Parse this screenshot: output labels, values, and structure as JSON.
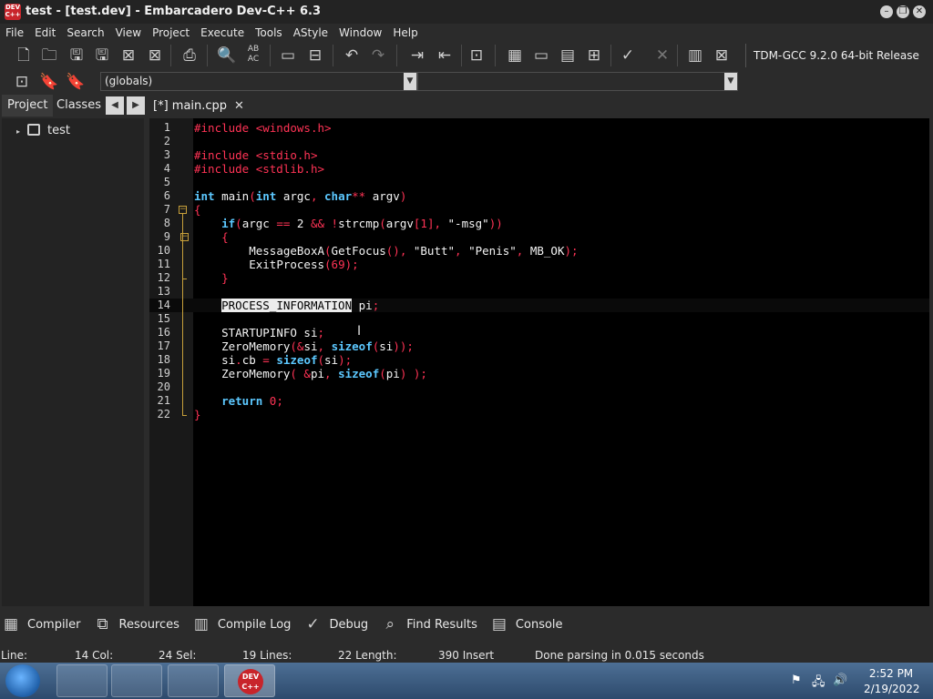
{
  "window": {
    "title": "test - [test.dev] - Embarcadero Dev-C++ 6.3",
    "logo_text": "DEV C++"
  },
  "menu": [
    "File",
    "Edit",
    "Search",
    "View",
    "Project",
    "Execute",
    "Tools",
    "AStyle",
    "Window",
    "Help"
  ],
  "toolbar": {
    "compiler": "TDM-GCC 9.2.0 64-bit Release",
    "globals_combo": "(globals)"
  },
  "left_panel": {
    "tabs": [
      "Project",
      "Classes"
    ],
    "tree_item": "test"
  },
  "editor": {
    "tab_label": "[*] main.cpp",
    "active_line": 14,
    "lines": [
      "1",
      "2",
      "3",
      "4",
      "5",
      "6",
      "7",
      "8",
      "9",
      "10",
      "11",
      "12",
      "13",
      "14",
      "15",
      "16",
      "17",
      "18",
      "19",
      "20",
      "21",
      "22"
    ]
  },
  "code": {
    "l1a": "#include ",
    "l1b": "<windows.h>",
    "l3a": "#include ",
    "l3b": "<stdio.h>",
    "l4a": "#include ",
    "l4b": "<stdlib.h>",
    "l6_int1": "int",
    "l6_main": " main",
    "l6_p1": "(",
    "l6_int2": "int",
    "l6_argc": " argc",
    "l6_comma": ",",
    "l6_char": " char",
    "l6_stars": "**",
    "l6_argv": " argv",
    "l6_p2": ")",
    "l7": "{",
    "l8_if": "if",
    "l8_p1": "(",
    "l8_argc": "argc ",
    "l8_eq": "==",
    "l8_two": " 2 ",
    "l8_and": "&& !",
    "l8_strcmp": "strcmp",
    "l8_p2": "(",
    "l8_argv": "argv",
    "l8_idx": "[1]",
    "l8_comma": ", ",
    "l8_str": "\"-msg\"",
    "l8_p3": "))",
    "l9": "{",
    "l10_fn": "MessageBoxA",
    "l10_p1": "(",
    "l10_gf": "GetFocus",
    "l10_p2": "(), ",
    "l10_s1": "\"Butt\"",
    "l10_c1": ", ",
    "l10_s2": "\"Penis\"",
    "l10_c2": ", ",
    "l10_mb": "MB_OK",
    "l10_end": ");",
    "l11_fn": "ExitProcess",
    "l11_p": "(69);",
    "l12": "}",
    "l14_sel": "PROCESS_INFORMATION",
    "l14_pi": " pi",
    "l14_semi": ";",
    "l16_a": "STARTUPINFO si",
    "l16_semi": ";",
    "l17_fn": "ZeroMemory",
    "l17_p1": "(&",
    "l17_si": "si",
    "l17_c": ", ",
    "l17_sz": "sizeof",
    "l17_p2": "(",
    "l17_si2": "si",
    "l17_end": "));",
    "l18_a": "si",
    "l18_dot": ".",
    "l18_cb": "cb ",
    "l18_eq": "= ",
    "l18_sz": "sizeof",
    "l18_p": "(",
    "l18_si": "si",
    "l18_end": ");",
    "l19_fn": "ZeroMemory",
    "l19_p1": "( &",
    "l19_pi": "pi",
    "l19_c": ", ",
    "l19_sz": "sizeof",
    "l19_p2": "(",
    "l19_pi2": "pi",
    "l19_end": ") );",
    "l21_ret": "return",
    "l21_zero": " 0",
    "l21_semi": ";",
    "l22": "}"
  },
  "bottom_tabs": [
    "Compiler",
    "Resources",
    "Compile Log",
    "Debug",
    "Find Results",
    "Console"
  ],
  "status": {
    "line_label": "Line:",
    "col": "14 Col:",
    "sel": "24 Sel:",
    "lines": "19 Lines:",
    "length": "22 Length:",
    "insert": "390 Insert",
    "message": "Done parsing in 0.015 seconds"
  },
  "taskbar": {
    "time": "2:52 PM",
    "date": "2/19/2022"
  },
  "colors": {
    "keyword": "#5cc8ff",
    "preprocessor": "#ff3355",
    "fold": "#c8a03a"
  }
}
